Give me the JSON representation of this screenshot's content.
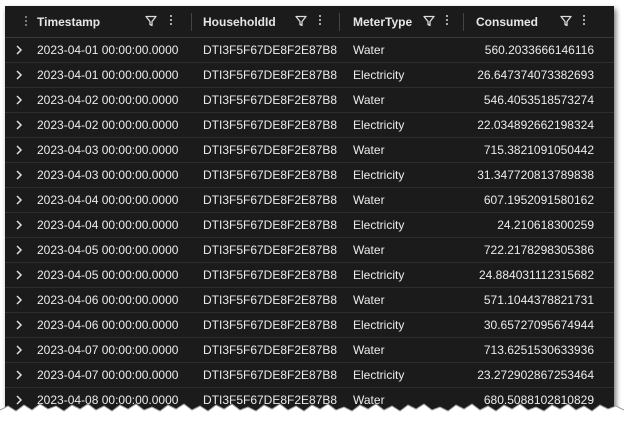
{
  "columns": {
    "timestamp": "Timestamp",
    "household": "HouseholdId",
    "meter": "MeterType",
    "consumed": "Consumed"
  },
  "rows": [
    {
      "timestamp": "2023-04-01 00:00:00.0000",
      "household": "DTI3F5F67DE8F2E87B8",
      "meter": "Water",
      "consumed": "560.2033666146116"
    },
    {
      "timestamp": "2023-04-01 00:00:00.0000",
      "household": "DTI3F5F67DE8F2E87B8",
      "meter": "Electricity",
      "consumed": "26.647374073382693"
    },
    {
      "timestamp": "2023-04-02 00:00:00.0000",
      "household": "DTI3F5F67DE8F2E87B8",
      "meter": "Water",
      "consumed": "546.4053518573274"
    },
    {
      "timestamp": "2023-04-02 00:00:00.0000",
      "household": "DTI3F5F67DE8F2E87B8",
      "meter": "Electricity",
      "consumed": "22.034892662198324"
    },
    {
      "timestamp": "2023-04-03 00:00:00.0000",
      "household": "DTI3F5F67DE8F2E87B8",
      "meter": "Water",
      "consumed": "715.3821091050442"
    },
    {
      "timestamp": "2023-04-03 00:00:00.0000",
      "household": "DTI3F5F67DE8F2E87B8",
      "meter": "Electricity",
      "consumed": "31.347720813789838"
    },
    {
      "timestamp": "2023-04-04 00:00:00.0000",
      "household": "DTI3F5F67DE8F2E87B8",
      "meter": "Water",
      "consumed": "607.1952091580162"
    },
    {
      "timestamp": "2023-04-04 00:00:00.0000",
      "household": "DTI3F5F67DE8F2E87B8",
      "meter": "Electricity",
      "consumed": "24.210618300259"
    },
    {
      "timestamp": "2023-04-05 00:00:00.0000",
      "household": "DTI3F5F67DE8F2E87B8",
      "meter": "Water",
      "consumed": "722.2178298305386"
    },
    {
      "timestamp": "2023-04-05 00:00:00.0000",
      "household": "DTI3F5F67DE8F2E87B8",
      "meter": "Electricity",
      "consumed": "24.884031112315682"
    },
    {
      "timestamp": "2023-04-06 00:00:00.0000",
      "household": "DTI3F5F67DE8F2E87B8",
      "meter": "Water",
      "consumed": "571.1044378821731"
    },
    {
      "timestamp": "2023-04-06 00:00:00.0000",
      "household": "DTI3F5F67DE8F2E87B8",
      "meter": "Electricity",
      "consumed": "30.65727095674944"
    },
    {
      "timestamp": "2023-04-07 00:00:00.0000",
      "household": "DTI3F5F67DE8F2E87B8",
      "meter": "Water",
      "consumed": "713.6251530633936"
    },
    {
      "timestamp": "2023-04-07 00:00:00.0000",
      "household": "DTI3F5F67DE8F2E87B8",
      "meter": "Electricity",
      "consumed": "23.272902867253464"
    },
    {
      "timestamp": "2023-04-08 00:00:00.0000",
      "household": "DTI3F5F67DE8F2E87B8",
      "meter": "Water",
      "consumed": "680.5088102810829"
    }
  ],
  "icons": {
    "filter": "filter-icon",
    "more": "more-options-icon",
    "expand": "chevron-right-icon",
    "resize": "column-resize-grip"
  },
  "colors": {
    "background": "#1b1b1b",
    "text": "#ececec",
    "row_divider": "#2e2e2e"
  }
}
